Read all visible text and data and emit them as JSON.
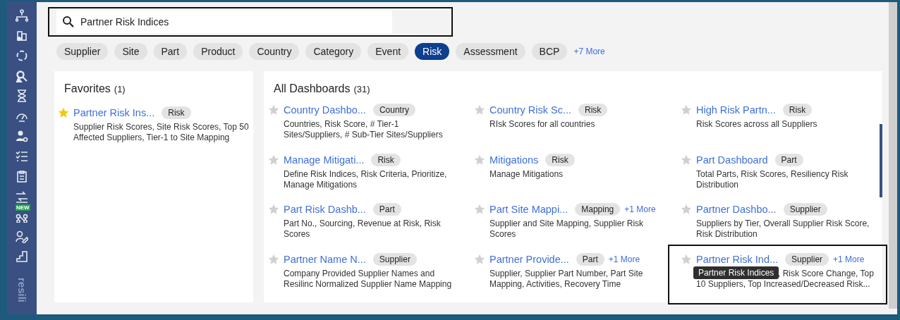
{
  "sidebar": {
    "items": [
      {
        "kind": "hierarchy"
      },
      {
        "kind": "buildings"
      },
      {
        "kind": "cycle"
      },
      {
        "kind": "magnifier"
      },
      {
        "kind": "hourglass"
      },
      {
        "kind": "gauge"
      },
      {
        "kind": "user-gear"
      },
      {
        "kind": "checklist"
      },
      {
        "kind": "clipboard"
      },
      {
        "kind": "transfer"
      },
      {
        "kind": "network",
        "badge": "NEW"
      },
      {
        "kind": "user-edit"
      },
      {
        "kind": "steps"
      }
    ],
    "logo": "resili"
  },
  "search": {
    "value": "Partner Risk Indices"
  },
  "filters": {
    "chips": [
      {
        "label": "Supplier",
        "selected": false
      },
      {
        "label": "Site",
        "selected": false
      },
      {
        "label": "Part",
        "selected": false
      },
      {
        "label": "Product",
        "selected": false
      },
      {
        "label": "Country",
        "selected": false
      },
      {
        "label": "Category",
        "selected": false
      },
      {
        "label": "Event",
        "selected": false
      },
      {
        "label": "Risk",
        "selected": true
      },
      {
        "label": "Assessment",
        "selected": false
      },
      {
        "label": "BCP",
        "selected": false
      }
    ],
    "more": "+7 More"
  },
  "favorites": {
    "title": "Favorites",
    "count": "(1)",
    "items": [
      {
        "title": "Partner Risk Ins...",
        "favorite": true,
        "tag": "Risk",
        "description": "Supplier Risk Scores, Site Risk Scores, Top 50 Affected Suppliers, Tier-1 to Site Mapping"
      }
    ]
  },
  "all_dashboards": {
    "title": "All Dashboards",
    "count": "(31)",
    "items": [
      {
        "title": "Country Dashbo...",
        "favorite": false,
        "tag": "Country",
        "description": "Countries, Risk Score, # Tier-1 Sites/Suppliers, # Sub-Tier Sites/Suppliers"
      },
      {
        "title": "Country Risk Sc...",
        "favorite": false,
        "tag": "Risk",
        "description": "RIsk Scores for all countries"
      },
      {
        "title": "High Risk Partn...",
        "favorite": false,
        "tag": "Risk",
        "description": "Risk Scores across all Suppliers"
      },
      {
        "title": "Manage Mitigati...",
        "favorite": false,
        "tag": "Risk",
        "description": "Define Risk Indices, Risk Criteria, Prioritize, Manage Mitigations"
      },
      {
        "title": "Mitigations",
        "favorite": false,
        "tag": "Risk",
        "description": "Manage Mitigations"
      },
      {
        "title": "Part Dashboard",
        "favorite": false,
        "tag": "Part",
        "description": "Total Parts, Risk Scores, Resiliency Risk Distribution"
      },
      {
        "title": "Part Risk Dashb...",
        "favorite": false,
        "tag": "Part",
        "description": "Part No., Sourcing, Revenue at Risk, Risk Scores"
      },
      {
        "title": "Part Site Mappi...",
        "favorite": false,
        "tag": "Mapping",
        "more": "+1 More",
        "description": "Supplier and Site Mapping, Supplier Risk Scores"
      },
      {
        "title": "Partner Dashbo...",
        "favorite": false,
        "tag": "Supplier",
        "description": "Suppliers by Tier, Overall Supplier Risk Score, Risk Distribution"
      },
      {
        "title": "Partner Name N...",
        "favorite": false,
        "tag": "Supplier",
        "description": "Company Provided Supplier Names and Resilinc Normalized Supplier Name Mapping"
      },
      {
        "title": "Partner Provide...",
        "favorite": false,
        "tag": "Part",
        "more": "+1 More",
        "description": "Supplier, Supplier Part Number, Part Site Mapping, Activities, Recovery Time"
      },
      {
        "title": "Partner Risk Ind...",
        "favorite": false,
        "tag": "Supplier",
        "more": "+1 More",
        "highlighted": true,
        "tooltip": "Partner Risk Indices",
        "description_lines": [
          ", Risk Score Change, Top",
          "10 Suppliers, Top Increased/Decreased Risk..."
        ]
      }
    ]
  }
}
